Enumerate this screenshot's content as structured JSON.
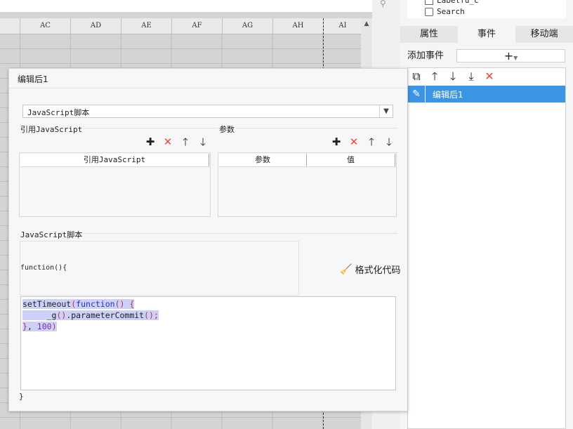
{
  "sheet": {
    "columns": [
      "AC",
      "AD",
      "AE",
      "AF",
      "AG",
      "AH",
      "AI"
    ]
  },
  "tree": {
    "items": [
      "Labelfu_c",
      "Search"
    ]
  },
  "right_panel": {
    "tabs": [
      "属性",
      "事件",
      "移动端"
    ],
    "active_tab": "事件",
    "add_event_label": "添加事件",
    "add_event_button": "+",
    "events": [
      "编辑后1"
    ]
  },
  "dialog": {
    "title": "编辑后1",
    "type_select": "JavaScript脚本",
    "ref_js_label": "引用JavaScript",
    "ref_js_header": "引用JavaScript",
    "params_label": "参数",
    "params_headers": [
      "参数",
      "值"
    ],
    "script_label": "JavaScript脚本",
    "func_open": "function(){",
    "format_button": "格式化代码",
    "code_lines": [
      {
        "a": "setTimeout",
        "b": "(",
        "c": "function",
        "d": "() {"
      },
      {
        "a": "     _g",
        "b": "()",
        "c": ".parameterCommit",
        "d": "();"
      },
      {
        "a": "}",
        "b": ", ",
        "c": "100",
        "d": ")"
      }
    ],
    "func_close": "}"
  },
  "colors": {
    "accent": "#3b95e5",
    "delete": "#e43"
  }
}
